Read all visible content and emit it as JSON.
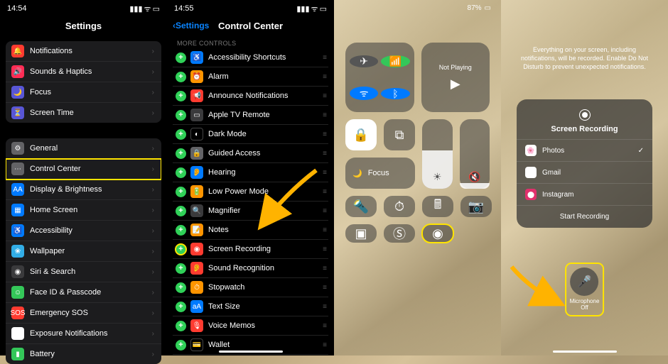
{
  "status_time": "14:54",
  "status_time2": "14:55",
  "panel1": {
    "title": "Settings",
    "group1": [
      {
        "label": "Notifications",
        "color": "c-red",
        "glyph": "🔔"
      },
      {
        "label": "Sounds & Haptics",
        "color": "c-pink",
        "glyph": "🔊"
      },
      {
        "label": "Focus",
        "color": "c-indigo",
        "glyph": "🌙"
      },
      {
        "label": "Screen Time",
        "color": "c-indigo",
        "glyph": "⏳"
      }
    ],
    "group2": [
      {
        "label": "General",
        "color": "c-gray",
        "glyph": "⚙"
      },
      {
        "label": "Control Center",
        "color": "c-gray",
        "glyph": "⋯",
        "hl": true
      },
      {
        "label": "Display & Brightness",
        "color": "c-blue",
        "glyph": "AA"
      },
      {
        "label": "Home Screen",
        "color": "c-blue",
        "glyph": "▦"
      },
      {
        "label": "Accessibility",
        "color": "c-blue",
        "glyph": "♿"
      },
      {
        "label": "Wallpaper",
        "color": "c-cyan",
        "glyph": "❀"
      },
      {
        "label": "Siri & Search",
        "color": "c-dkgray",
        "glyph": "◉"
      },
      {
        "label": "Face ID & Passcode",
        "color": "c-green",
        "glyph": "☺"
      },
      {
        "label": "Emergency SOS",
        "color": "c-red",
        "glyph": "SOS"
      },
      {
        "label": "Exposure Notifications",
        "color": "c-white",
        "glyph": "✳"
      },
      {
        "label": "Battery",
        "color": "c-green",
        "glyph": "▮"
      }
    ]
  },
  "panel2": {
    "back": "Settings",
    "title": "Control Center",
    "section": "MORE CONTROLS",
    "items": [
      {
        "label": "Accessibility Shortcuts",
        "color": "c-blue",
        "glyph": "♿"
      },
      {
        "label": "Alarm",
        "color": "c-orange",
        "glyph": "⏰"
      },
      {
        "label": "Announce Notifications",
        "color": "c-red",
        "glyph": "📢"
      },
      {
        "label": "Apple TV Remote",
        "color": "c-dkgray",
        "glyph": "▭"
      },
      {
        "label": "Dark Mode",
        "color": "c-black",
        "glyph": "◐"
      },
      {
        "label": "Guided Access",
        "color": "c-gray",
        "glyph": "🔒"
      },
      {
        "label": "Hearing",
        "color": "c-blue",
        "glyph": "👂"
      },
      {
        "label": "Low Power Mode",
        "color": "c-orange",
        "glyph": "🔋"
      },
      {
        "label": "Magnifier",
        "color": "c-dkgray",
        "glyph": "🔍"
      },
      {
        "label": "Notes",
        "color": "c-orange",
        "glyph": "📝"
      },
      {
        "label": "Screen Recording",
        "color": "c-red",
        "glyph": "◉",
        "hl": true
      },
      {
        "label": "Sound Recognition",
        "color": "c-red",
        "glyph": "👂"
      },
      {
        "label": "Stopwatch",
        "color": "c-orange",
        "glyph": "⏱"
      },
      {
        "label": "Text Size",
        "color": "c-blue",
        "glyph": "aA"
      },
      {
        "label": "Voice Memos",
        "color": "c-red",
        "glyph": "🎙"
      },
      {
        "label": "Wallet",
        "color": "c-black",
        "glyph": "💳"
      }
    ]
  },
  "panel3": {
    "battery_pct": "87%",
    "not_playing": "Not Playing",
    "focus_label": "Focus"
  },
  "panel4": {
    "hint": "Everything on your screen, including notifications, will be recorded. Enable Do Not Disturb to prevent unexpected notifications.",
    "sheet_title": "Screen Recording",
    "apps": [
      {
        "label": "Photos",
        "color": "#fff",
        "emoji": "🌸",
        "checked": true
      },
      {
        "label": "Gmail",
        "color": "#fff",
        "emoji": "M",
        "checked": false
      },
      {
        "label": "Instagram",
        "color": "#e1306c",
        "emoji": "⬤",
        "checked": false
      }
    ],
    "start": "Start Recording",
    "mic_label": "Microphone",
    "mic_state": "Off"
  }
}
